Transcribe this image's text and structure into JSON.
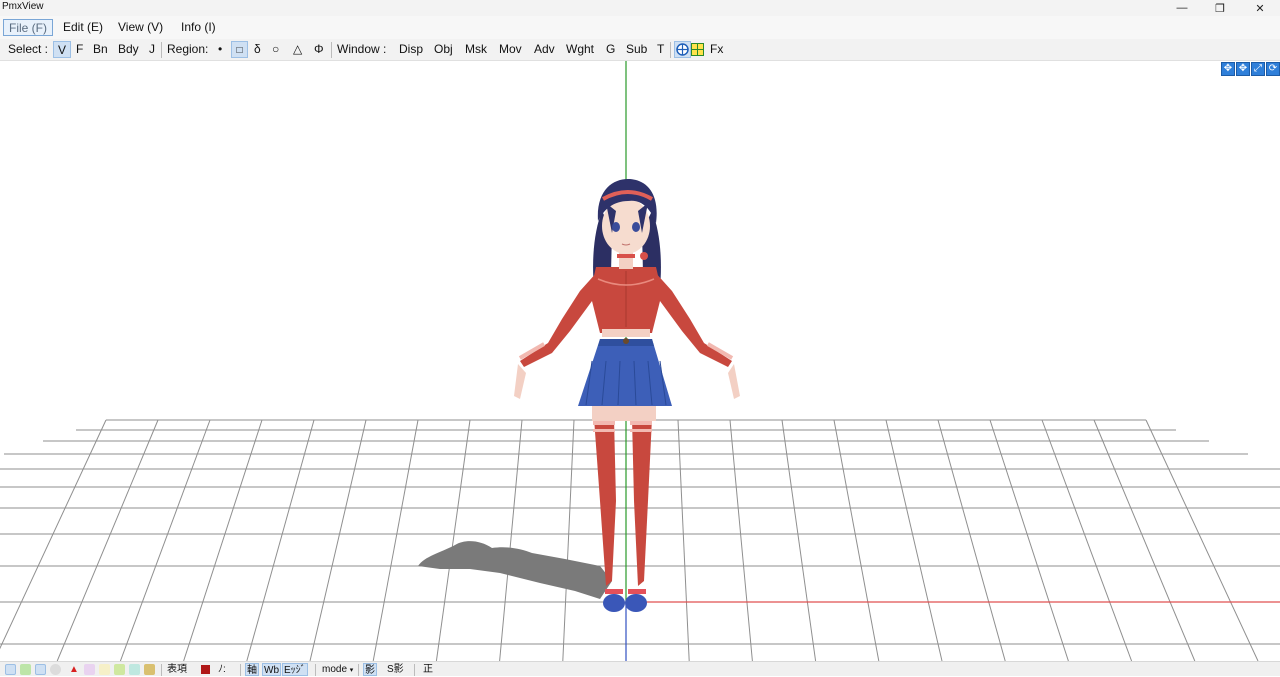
{
  "app": {
    "title": "PmxView"
  },
  "window_controls": {
    "minimize": "—",
    "restore": "❐",
    "close": "✕"
  },
  "menu": {
    "items": [
      "File (F)",
      "Edit (E)",
      "View (V)",
      "Info (I)"
    ]
  },
  "toolbar": {
    "select_label": "Select :",
    "select_items": [
      "V",
      "F",
      "Bn",
      "Bdy",
      "J"
    ],
    "region_label": "Region:",
    "region_items": [
      "•",
      "□",
      "δ",
      "○",
      "△",
      "Φ"
    ],
    "window_label": "Window :",
    "window_items": [
      "Disp",
      "Obj",
      "Msk",
      "Mov",
      "Adv",
      "Wght",
      "G",
      "Sub",
      "T"
    ],
    "fx_label": "Fx"
  },
  "nav_icons": [
    "move-xy-icon",
    "move-xz-icon",
    "zoom-icon",
    "rotate-icon"
  ],
  "status": {
    "morph_label": "表項",
    "no_label": "ﾉ:",
    "axis_label": "軸",
    "wb_label": "Wb",
    "edge_label": "Eｯｼﾞ",
    "mode_label": "mode",
    "shadow_label": "影",
    "sshadow_label": "S影",
    "front_label": "正"
  },
  "colors": {
    "accent_blue": "#2f7fd9",
    "y_axis": "#2a9a2a",
    "x_axis": "#e05050",
    "grid": "#8a8a8a"
  }
}
